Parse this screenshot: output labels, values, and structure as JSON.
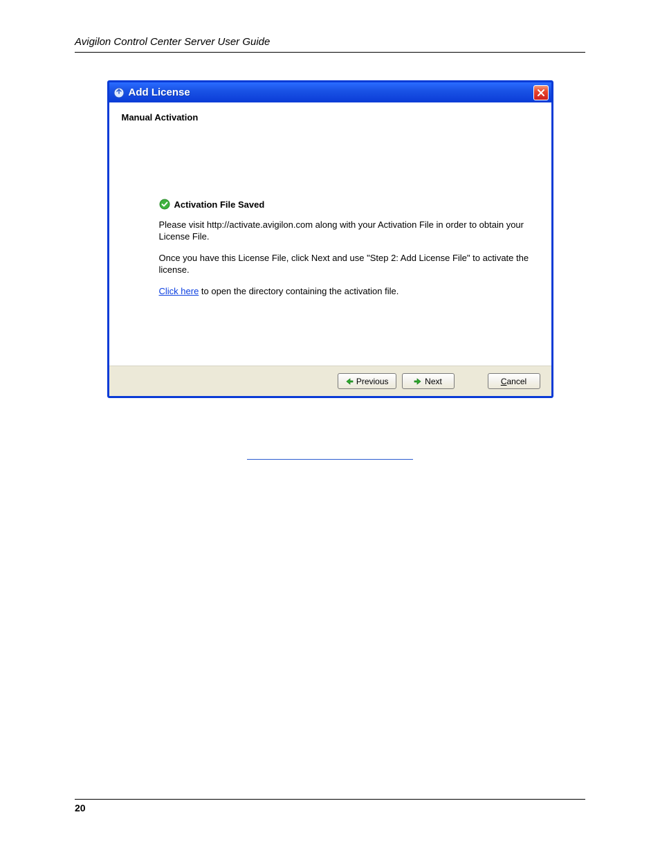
{
  "doc": {
    "header": "Avigilon Control Center Server User Guide",
    "page_number": "20"
  },
  "dialog": {
    "title": "Add License",
    "section_title": "Manual Activation",
    "status_heading": "Activation File Saved",
    "para1": "Please visit http://activate.avigilon.com along with your Activation File in order to obtain your License File.",
    "para2": "Once you have this License File, click Next and use \"Step 2: Add License File\" to activate the license.",
    "link_text": "Click here",
    "para3_tail": " to open the directory containing the activation file.",
    "buttons": {
      "previous": "Previous",
      "next": "Next",
      "cancel_prefix": "C",
      "cancel_rest": "ancel"
    }
  }
}
